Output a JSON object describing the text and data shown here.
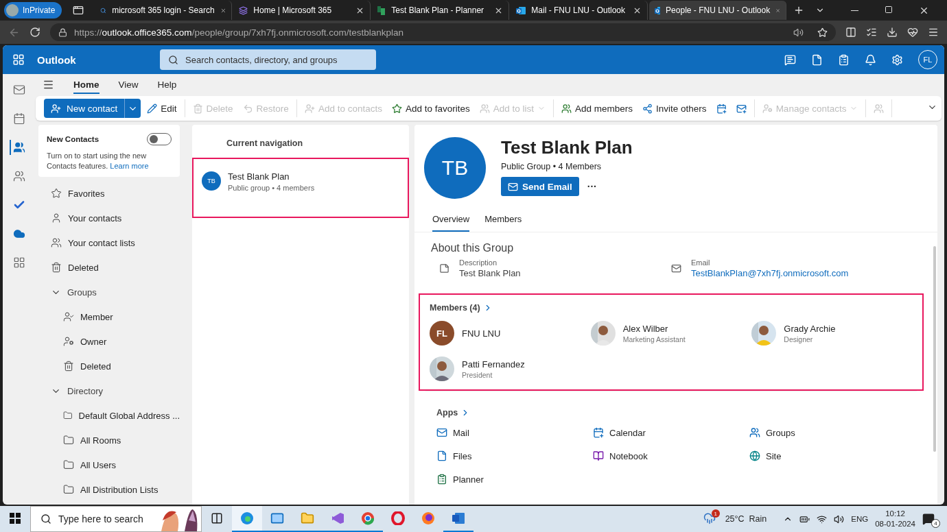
{
  "browser": {
    "profile": "InPrivate",
    "tabs": [
      {
        "title": "microsoft 365 login - Search",
        "kind": "search",
        "selected": false
      },
      {
        "title": "Home | Microsoft 365",
        "kind": "m365",
        "selected": false
      },
      {
        "title": "Test Blank Plan - Planner",
        "kind": "planner",
        "selected": false
      },
      {
        "title": "Mail - FNU LNU - Outlook",
        "kind": "outlook",
        "selected": false
      },
      {
        "title": "People - FNU LNU - Outlook",
        "kind": "outlook",
        "selected": true
      }
    ],
    "url": {
      "scheme": "https://",
      "host": "outlook.office365.com",
      "path": "/people/group/7xh7fj.onmicrosoft.com/testblankplan"
    }
  },
  "header": {
    "app": "Outlook",
    "search_placeholder": "Search contacts, directory, and groups",
    "initials": "FL"
  },
  "rail": [
    {
      "kind": "mail",
      "selected": false
    },
    {
      "kind": "calendar",
      "selected": false
    },
    {
      "kind": "people",
      "selected": true
    },
    {
      "kind": "groups",
      "selected": false
    },
    {
      "kind": "todo",
      "selected": false
    },
    {
      "kind": "onedrive",
      "selected": false
    },
    {
      "kind": "apps",
      "selected": false
    }
  ],
  "ribbon_tabs": [
    {
      "label": "Home",
      "selected": true
    },
    {
      "label": "View",
      "selected": false
    },
    {
      "label": "Help",
      "selected": false
    }
  ],
  "ribbon_groups": [
    [
      {
        "kind": "split",
        "label": "New contact",
        "disabled": false
      },
      {
        "kind": "button",
        "label": "Edit",
        "disabled": false
      }
    ],
    [
      {
        "kind": "button",
        "label": "Delete",
        "disabled": true
      },
      {
        "kind": "button",
        "label": "Restore",
        "disabled": true
      }
    ],
    [
      {
        "kind": "button",
        "label": "Add to contacts",
        "disabled": true
      },
      {
        "kind": "button",
        "label": "Add to favorites",
        "disabled": false
      },
      {
        "kind": "dropdown",
        "label": "Add to list",
        "disabled": true
      }
    ],
    [
      {
        "kind": "button",
        "label": "Add members",
        "disabled": false
      },
      {
        "kind": "button",
        "label": "Invite others",
        "disabled": false
      },
      {
        "kind": "icon",
        "disabled": false
      },
      {
        "kind": "icon",
        "disabled": false
      }
    ],
    [
      {
        "kind": "dropdown",
        "label": "Manage contacts",
        "disabled": true
      }
    ],
    [
      {
        "kind": "icon",
        "disabled": true
      }
    ]
  ],
  "new_contacts": {
    "title": "New Contacts",
    "on": false,
    "text": "Turn on to start using the new Contacts features.",
    "link": "Learn more"
  },
  "folders": [
    {
      "label": "Favorites",
      "kind": "star"
    },
    {
      "label": "Your contacts",
      "kind": "person"
    },
    {
      "label": "Your contact lists",
      "kind": "list"
    },
    {
      "label": "Deleted",
      "kind": "trash"
    },
    {
      "label": "Groups",
      "kind": "section",
      "expanded": true,
      "children": [
        {
          "label": "Member",
          "kind": "member"
        },
        {
          "label": "Owner",
          "kind": "owner"
        },
        {
          "label": "Deleted",
          "kind": "trash"
        }
      ]
    },
    {
      "label": "Directory",
      "kind": "section",
      "expanded": true,
      "children": [
        {
          "label": "Default Global Address ...",
          "kind": "folder"
        },
        {
          "label": "All Rooms",
          "kind": "folder"
        },
        {
          "label": "All Users",
          "kind": "folder"
        },
        {
          "label": "All Distribution Lists",
          "kind": "folder"
        }
      ]
    }
  ],
  "navigation": {
    "heading": "Current navigation",
    "items": [
      {
        "initials": "TB",
        "name": "Test Blank Plan",
        "subtitle": "Public group • 4 members",
        "selected": true,
        "highlighted": true
      }
    ]
  },
  "group": {
    "initials": "TB",
    "name": "Test Blank Plan",
    "subtitle": "Public Group • 4 Members",
    "send_button": "Send Email",
    "more": "···",
    "tabs": [
      {
        "label": "Overview",
        "selected": true
      },
      {
        "label": "Members",
        "selected": false
      }
    ],
    "about_heading": "About this Group",
    "fields": [
      {
        "kind": "description",
        "label": "Description",
        "value": "Test Blank Plan"
      },
      {
        "kind": "email",
        "label": "Email",
        "value": "TestBlankPlan@7xh7fj.onmicrosoft.com"
      }
    ],
    "members_heading": "Members (4)",
    "members_highlighted": true,
    "members": [
      {
        "name": "FNU LNU",
        "initials": "FL",
        "color": "#8a4b2a"
      },
      {
        "name": "Alex Wilber",
        "role": "Marketing Assistant",
        "kind": "picture"
      },
      {
        "name": "Grady Archie",
        "role": "Designer",
        "kind": "picture"
      },
      {
        "name": "Patti Fernandez",
        "role": "President",
        "kind": "picture"
      }
    ],
    "apps_heading": "Apps",
    "apps": [
      {
        "label": "Mail",
        "kind": "mail"
      },
      {
        "label": "Calendar",
        "kind": "calendar"
      },
      {
        "label": "Groups",
        "kind": "groups"
      },
      {
        "label": "Files",
        "kind": "files"
      },
      {
        "label": "Notebook",
        "kind": "notebook"
      },
      {
        "label": "Site",
        "kind": "site"
      },
      {
        "label": "Planner",
        "kind": "planner"
      }
    ]
  },
  "taskbar": {
    "search_placeholder": "Type here to search",
    "apps": [
      {
        "kind": "taskview",
        "running": false,
        "active": false
      },
      {
        "kind": "edge",
        "running": true,
        "active": true
      },
      {
        "kind": "mail",
        "running": true,
        "active": false
      },
      {
        "kind": "explorer",
        "running": true,
        "active": false
      },
      {
        "kind": "vs",
        "running": true,
        "active": false
      },
      {
        "kind": "chrome",
        "running": true,
        "active": false
      },
      {
        "kind": "opera",
        "running": false,
        "active": false
      },
      {
        "kind": "firefox",
        "running": false,
        "active": false
      },
      {
        "kind": "word",
        "running": true,
        "active": false
      }
    ],
    "weather_badge": "1",
    "weather": "25°C  Rain",
    "language": "ENG",
    "time": "10:12",
    "date": "08-01-2024",
    "notifications": "4"
  }
}
